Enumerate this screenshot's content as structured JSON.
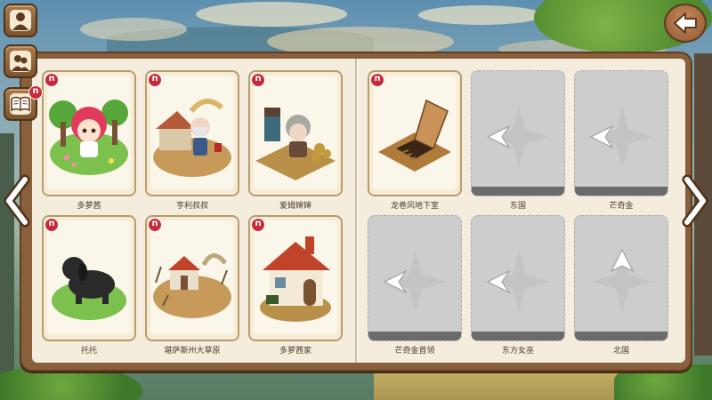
{
  "side_menu": [
    {
      "name": "profile-icon"
    },
    {
      "name": "friends-icon"
    },
    {
      "name": "book-icon",
      "badge": "n"
    }
  ],
  "back_button": {
    "icon": "back-arrow-icon"
  },
  "nav": {
    "prev_icon": "chevron-left-icon",
    "next_icon": "chevron-right-icon"
  },
  "badge_text": "n",
  "left_page": {
    "cards": [
      {
        "label": "多萝茜",
        "badge": "n",
        "icon": "dorothy-character-icon"
      },
      {
        "label": "亨利叔叔",
        "badge": "n",
        "icon": "uncle-henry-icon"
      },
      {
        "label": "爱姆婶婶",
        "badge": "n",
        "icon": "aunt-em-icon"
      },
      {
        "label": "托托",
        "badge": "n",
        "icon": "toto-dog-icon"
      },
      {
        "label": "堪萨斯州大草原",
        "badge": "n",
        "icon": "kansas-prairie-icon"
      },
      {
        "label": "多萝茜家",
        "badge": "n",
        "icon": "dorothy-house-icon"
      }
    ]
  },
  "right_page": {
    "cards": [
      {
        "label": "龙卷风地下室",
        "badge": "n",
        "locked": false,
        "icon": "cellar-trapdoor-icon"
      },
      {
        "label": "东国",
        "locked": true,
        "icon": "compass-icon"
      },
      {
        "label": "芒奇金",
        "locked": true,
        "icon": "compass-icon"
      },
      {
        "label": "芒奇金首领",
        "locked": true,
        "icon": "compass-icon"
      },
      {
        "label": "东方女巫",
        "locked": true,
        "icon": "compass-icon"
      },
      {
        "label": "北国",
        "locked": true,
        "icon": "compass-icon"
      }
    ]
  },
  "colors": {
    "panel": "#8a5f3c",
    "paper": "#f4eddd",
    "badge": "#c92a3a",
    "locked": "#cdcdcd"
  }
}
